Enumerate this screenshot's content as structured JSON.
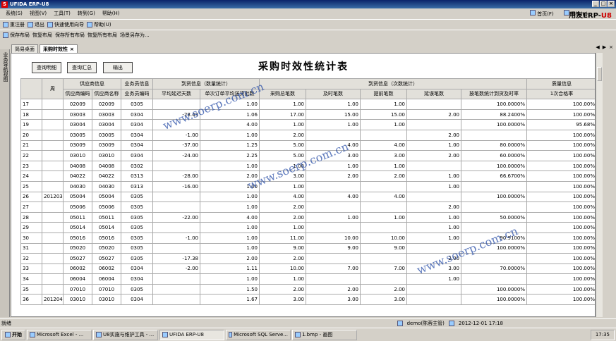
{
  "window": {
    "title": "UFIDA ERP-U8",
    "logo": "S",
    "btn_min": "_",
    "btn_max": "□",
    "btn_close": "×"
  },
  "menu": [
    "系统(S)",
    "视图(V)",
    "工具(T)",
    "转到(G)",
    "帮助(H)"
  ],
  "top_links": {
    "home": "首页(F)",
    "nav": "导航(K)"
  },
  "brand": {
    "name": "用友ERP-",
    "suffix": "U8"
  },
  "toolbar1": [
    "重注册",
    "退出",
    "快速使用向导",
    "帮助(U)"
  ],
  "toolbar2": [
    "保存布局",
    "恢复布局",
    "保存所有布局",
    "恢复所有布局",
    "场景另存为..."
  ],
  "sidebar_label": "业务导航视图",
  "tabs": [
    {
      "label": "简易桌面",
      "active": false
    },
    {
      "label": "采购时效性",
      "active": true,
      "close": "×"
    }
  ],
  "buttons": {
    "query_detail": "查询明细",
    "query_summary": "查询汇总",
    "export": "输出"
  },
  "report_title": "采购时效性统计表",
  "headers": {
    "row1": {
      "period": "周",
      "supplier": "供应商信息",
      "salesman": "业务员信息",
      "arrival_qty": "到货信息（数量统计）",
      "arrival_count": "到货信息（次数统计）",
      "quality": "质量信息"
    },
    "row2": [
      "供应商编码",
      "供应商名称",
      "业务员编码",
      "平均延迟天数",
      "单次订单平均送货批数",
      "采购总笔数",
      "及时笔数",
      "提前笔数",
      "延误笔数",
      "按笔数统计到货及时率",
      "1次合格率"
    ]
  },
  "rows": [
    [
      "17",
      "",
      "02009",
      "02009",
      "0305",
      "",
      "1.00",
      "1.00",
      "1.00",
      "1.00",
      "",
      "100.0000%",
      "100.00%"
    ],
    [
      "18",
      "",
      "03003",
      "03003",
      "0304",
      "-28.43",
      "1.06",
      "17.00",
      "15.00",
      "15.00",
      "2.00",
      "88.2400%",
      "100.00%"
    ],
    [
      "19",
      "",
      "03004",
      "03004",
      "0304",
      "",
      "4.00",
      "1.00",
      "1.00",
      "1.00",
      "",
      "100.0000%",
      "95.68%"
    ],
    [
      "20",
      "",
      "03005",
      "03005",
      "0304",
      "-1.00",
      "1.00",
      "2.00",
      "",
      "",
      "2.00",
      "",
      "100.00%"
    ],
    [
      "21",
      "",
      "03009",
      "03009",
      "0304",
      "-37.00",
      "1.25",
      "5.00",
      "4.00",
      "4.00",
      "1.00",
      "80.0000%",
      "100.00%"
    ],
    [
      "22",
      "",
      "03010",
      "03010",
      "0304",
      "-24.00",
      "2.25",
      "5.00",
      "3.00",
      "3.00",
      "2.00",
      "60.0000%",
      "100.00%"
    ],
    [
      "23",
      "",
      "04008",
      "04008",
      "0302",
      "",
      "1.00",
      "1.00",
      "1.00",
      "1.00",
      "",
      "100.0000%",
      "100.00%"
    ],
    [
      "24",
      "",
      "04022",
      "04022",
      "0313",
      "-28.00",
      "2.00",
      "3.00",
      "2.00",
      "2.00",
      "1.00",
      "66.6700%",
      "100.00%"
    ],
    [
      "25",
      "",
      "04030",
      "04030",
      "0313",
      "-16.00",
      "1.00",
      "1.00",
      "",
      "",
      "1.00",
      "",
      "100.00%"
    ],
    [
      "26",
      "201203",
      "05004",
      "05004",
      "0305",
      "",
      "1.00",
      "4.00",
      "4.00",
      "4.00",
      "",
      "100.0000%",
      "100.00%"
    ],
    [
      "27",
      "",
      "05006",
      "05006",
      "0305",
      "",
      "1.00",
      "2.00",
      "",
      "",
      "2.00",
      "",
      "100.00%"
    ],
    [
      "28",
      "",
      "05011",
      "05011",
      "0305",
      "-22.00",
      "4.00",
      "2.00",
      "1.00",
      "1.00",
      "1.00",
      "50.0000%",
      "100.00%"
    ],
    [
      "29",
      "",
      "05014",
      "05014",
      "0305",
      "",
      "1.00",
      "1.00",
      "",
      "",
      "1.00",
      "",
      "100.00%"
    ],
    [
      "30",
      "",
      "05016",
      "05016",
      "0305",
      "-1.00",
      "1.00",
      "11.00",
      "10.00",
      "10.00",
      "1.00",
      "90.9100%",
      "100.00%"
    ],
    [
      "31",
      "",
      "05020",
      "05020",
      "0305",
      "",
      "1.00",
      "9.00",
      "9.00",
      "9.00",
      "",
      "100.0000%",
      "100.00%"
    ],
    [
      "32",
      "",
      "05027",
      "05027",
      "0305",
      "-17.38",
      "2.00",
      "2.00",
      "",
      "",
      "2.00",
      "",
      "100.00%"
    ],
    [
      "33",
      "",
      "06002",
      "06002",
      "0304",
      "-2.00",
      "1.11",
      "10.00",
      "7.00",
      "7.00",
      "3.00",
      "70.0000%",
      "100.00%"
    ],
    [
      "34",
      "",
      "06004",
      "06004",
      "0304",
      "",
      "1.00",
      "1.00",
      "",
      "",
      "1.00",
      "",
      "100.00%"
    ],
    [
      "35",
      "",
      "07010",
      "07010",
      "0305",
      "",
      "1.50",
      "2.00",
      "2.00",
      "2.00",
      "",
      "100.0000%",
      "100.00%"
    ],
    [
      "36",
      "201204",
      "03010",
      "03010",
      "0304",
      "",
      "1.67",
      "3.00",
      "3.00",
      "3.00",
      "",
      "100.0000%",
      "100.00%"
    ]
  ],
  "status": {
    "left": "就绪",
    "user": "demo(陈蓉主管)",
    "datetime": "2012-12-01 17:18"
  },
  "taskbar": {
    "start": "开始",
    "tasks": [
      "Microsoft Excel - ...",
      "U8实施与维护工具 - ...",
      "UFIDA ERP-U8",
      "Microsoft SQL Serve...",
      "1.bmp - 画图"
    ],
    "active_task": 2,
    "clock": "17:35"
  },
  "watermark": "www.soerp.com.cn"
}
